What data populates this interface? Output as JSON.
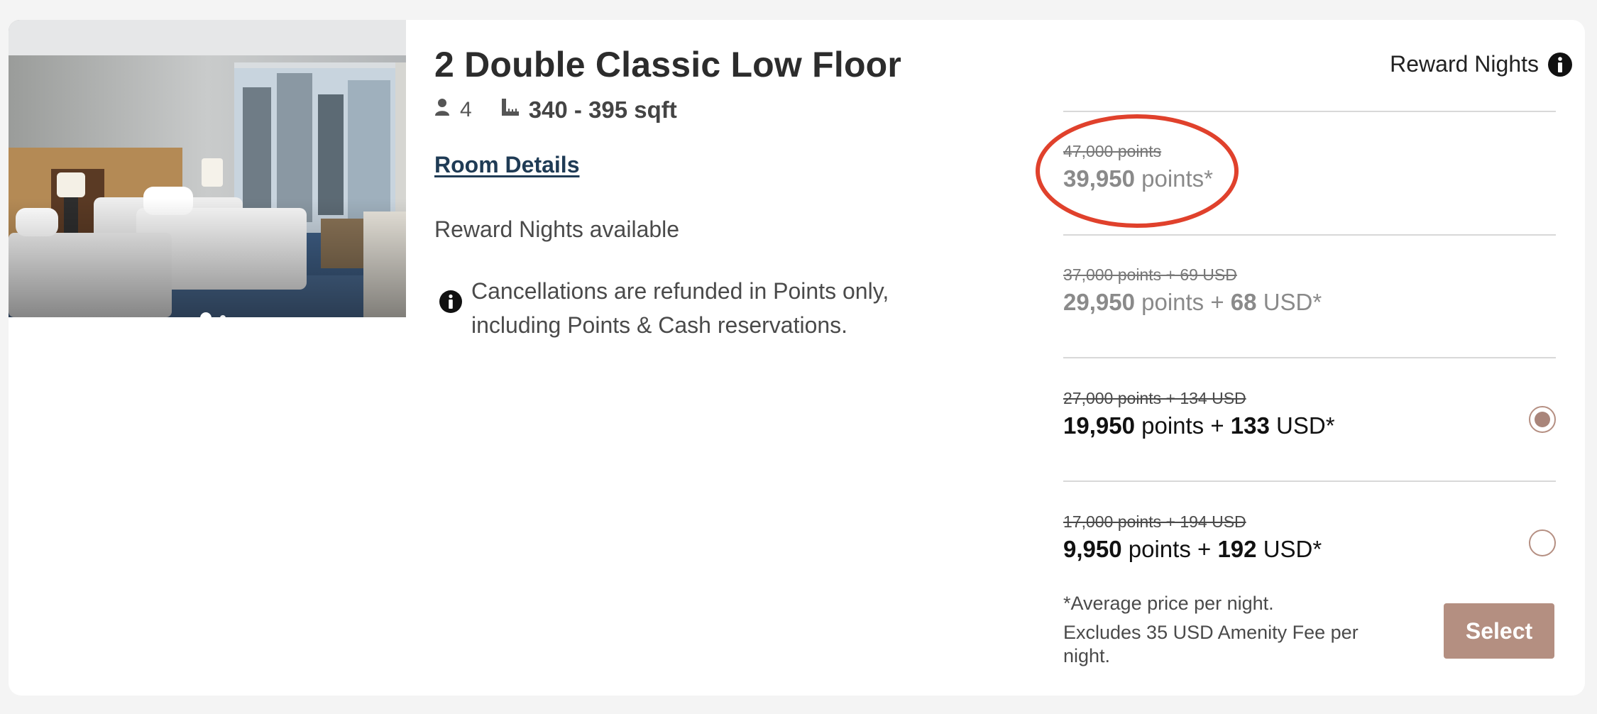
{
  "room": {
    "title": "2 Double Classic Low Floor",
    "occupancy": "4",
    "size": "340 - 395 sqft",
    "details_link": "Room Details",
    "availability": "Reward Nights available",
    "cancellation_line1": "Cancellations are refunded in Points only,",
    "cancellation_line2": "including Points & Cash reservations.",
    "photo_count": 2,
    "active_photo": 1
  },
  "rates": {
    "header": "Reward Nights",
    "options": [
      {
        "original": "47,000 points",
        "points": "39,950",
        "points_unit": "points*",
        "selected": false
      },
      {
        "original": "37,000 points + 69 USD",
        "points": "29,950",
        "points_unit": "points",
        "plus": "+",
        "cash": "68",
        "cash_unit": "USD*",
        "selected": false
      },
      {
        "original": "27,000 points + 134 USD",
        "points": "19,950",
        "points_unit": "points",
        "plus": "+",
        "cash": "133",
        "cash_unit": "USD*",
        "selected": true
      },
      {
        "original": "17,000 points + 194 USD",
        "points": "9,950",
        "points_unit": "points",
        "plus": "+",
        "cash": "192",
        "cash_unit": "USD*",
        "selected": false
      }
    ],
    "average_note": "*Average price per night.",
    "fee_note": "Excludes 35 USD Amenity Fee per night.",
    "select_label": "Select"
  },
  "colors": {
    "accent": "#b48f81",
    "link": "#1f3b55",
    "annotation": "#e0412c"
  },
  "icons": {
    "occupancy": "person-icon",
    "size": "ruler-icon",
    "info": "info-icon"
  }
}
